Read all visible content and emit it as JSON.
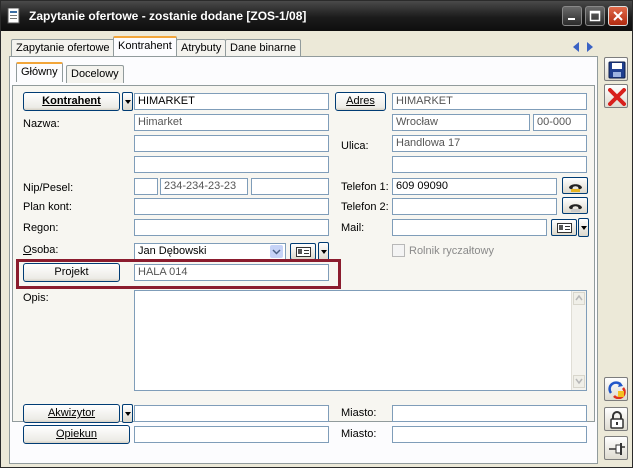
{
  "window": {
    "title": "Zapytanie ofertowe - zostanie dodane [ZOS-1/08]"
  },
  "tabs": [
    {
      "label": "Zapytanie ofertowe",
      "active": false
    },
    {
      "label": "Kontrahent",
      "active": true
    },
    {
      "label": "Atrybuty",
      "active": false
    },
    {
      "label": "Dane binarne",
      "active": false
    }
  ],
  "subtabs": [
    {
      "label": "Główny",
      "active": true
    },
    {
      "label": "Docelowy",
      "active": false
    }
  ],
  "contractor": {
    "button_label": "Kontrahent",
    "code": "HIMARKET",
    "name_label": "Nazwa:",
    "name1": "Himarket",
    "name2": "",
    "name3": "",
    "nip_label": "Nip/Pesel:",
    "nip_prefix": "",
    "nip": "234-234-23-23",
    "nip_extra": "",
    "plan_label": "Plan kont:",
    "plan": "",
    "regon_label": "Regon:",
    "regon": "",
    "osoba_label": "Osoba:",
    "osoba": "Jan Dębowski"
  },
  "address": {
    "button_label": "Adres",
    "code": "HIMARKET",
    "city": "Wrocław",
    "postal": "00-000",
    "street_label": "Ulica:",
    "street": "Handlowa 17",
    "street2": "",
    "phone1_label": "Telefon 1:",
    "phone1": "609 09090",
    "phone2_label": "Telefon 2:",
    "phone2": "",
    "mail_label": "Mail:",
    "mail": "",
    "rolnik_label": "Rolnik ryczałtowy"
  },
  "project": {
    "button_label": "Projekt",
    "value": "HALA 014"
  },
  "opis": {
    "label": "Opis:",
    "value": ""
  },
  "bottom": {
    "akwizytor_label": "Akwizytor",
    "akwizytor": "",
    "opiekun_label": "Opiekun",
    "opiekun": "",
    "miasto_label": "Miasto:",
    "miasto1": "",
    "miasto2": ""
  },
  "icons": {
    "save": "save-icon",
    "cancel": "cancel-icon",
    "refresh": "refresh-icon",
    "lock": "lock-icon",
    "pin": "pin-icon",
    "phone": "phone-icon",
    "card": "card-icon"
  },
  "colors": {
    "highlight": "#8b1c2e",
    "active_tab": "#f2a63b"
  }
}
